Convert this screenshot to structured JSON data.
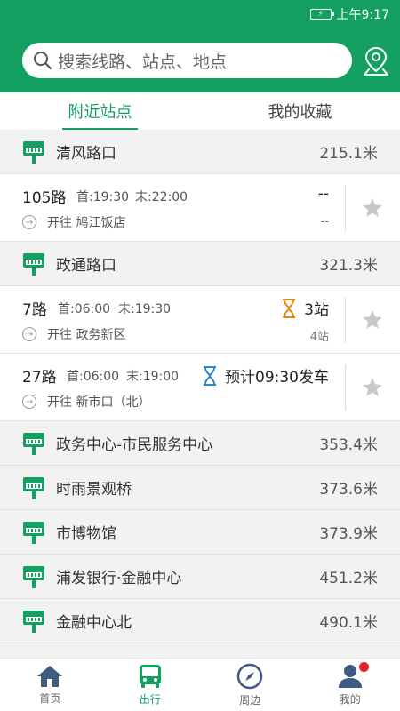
{
  "status_bar": {
    "time": "上午9:17"
  },
  "search": {
    "placeholder": "搜索线路、站点、地点"
  },
  "tabs": [
    {
      "label": "附近站点",
      "active": true
    },
    {
      "label": "我的收藏",
      "active": false
    }
  ],
  "stops": [
    {
      "name": "清风路口",
      "distance": "215.1米",
      "routes": [
        {
          "name": "105路",
          "first": "首:19:30",
          "last": "末:22:00",
          "direction": "开往 鸠江饭店",
          "status": "--",
          "sub": "--",
          "hourglass": ""
        }
      ]
    },
    {
      "name": "政通路口",
      "distance": "321.3米",
      "routes": [
        {
          "name": "7路",
          "first": "首:06:00",
          "last": "末:19:30",
          "direction": "开往 政务新区",
          "status": "3站",
          "sub": "4站",
          "hourglass": "orange"
        },
        {
          "name": "27路",
          "first": "首:06:00",
          "last": "末:19:00",
          "direction": "开往 新市口（北）",
          "status": "预计09:30发车",
          "sub": "",
          "hourglass": "blue"
        }
      ]
    },
    {
      "name": "政务中心-市民服务中心",
      "distance": "353.4米",
      "routes": []
    },
    {
      "name": "时雨景观桥",
      "distance": "373.6米",
      "routes": []
    },
    {
      "name": "市博物馆",
      "distance": "373.9米",
      "routes": []
    },
    {
      "name": "浦发银行·金融中心",
      "distance": "451.2米",
      "routes": []
    },
    {
      "name": "金融中心北",
      "distance": "490.1米",
      "routes": []
    }
  ],
  "bottom_nav": [
    {
      "label": "首页",
      "icon": "home-icon",
      "active": false
    },
    {
      "label": "出行",
      "icon": "bus-icon",
      "active": true
    },
    {
      "label": "周边",
      "icon": "compass-icon",
      "active": false
    },
    {
      "label": "我的",
      "icon": "user-icon",
      "active": false,
      "badge": true
    }
  ],
  "colors": {
    "primary": "#14a060",
    "hourglass_orange": "#e08a1e",
    "hourglass_blue": "#2a8ac8",
    "star": "#c8c8c8",
    "badge": "#e5222d"
  }
}
